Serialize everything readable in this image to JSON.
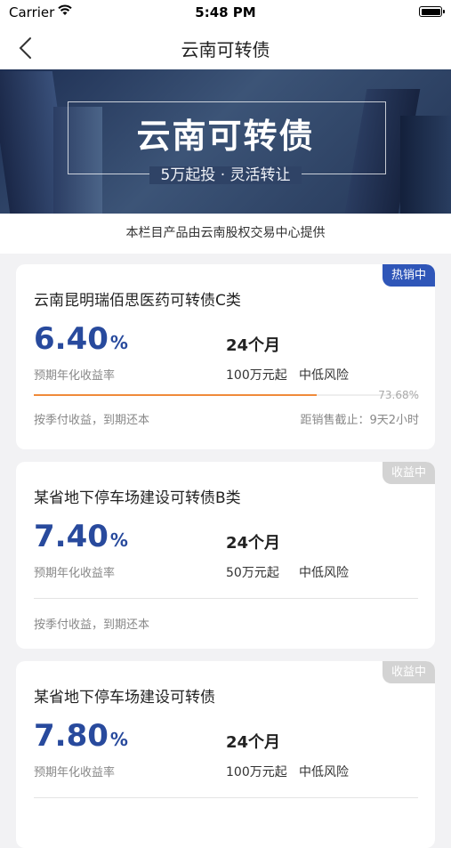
{
  "status": {
    "carrier": "Carrier",
    "time": "5:48 PM"
  },
  "nav": {
    "title": "云南可转债"
  },
  "banner": {
    "title": "云南可转债",
    "subtitle": "5万起投 · 灵活转让"
  },
  "provider_note": "本栏目产品由云南股权交易中心提供",
  "products": [
    {
      "tag": "热销中",
      "tag_color": "#2f56b8",
      "name": "云南昆明瑞佰思医药可转债C类",
      "rate": "6.40",
      "rate_unit": "%",
      "rate_label": "预期年化收益率",
      "term": "24个月",
      "min_invest": "100万元起",
      "risk": "中低风险",
      "progress_percent": 73.68,
      "progress_text": "73.68%",
      "payment": "按季付收益，到期还本",
      "deadline": "距销售截止：9天2小时"
    },
    {
      "tag": "收益中",
      "tag_color": "#d3d3d3",
      "name": "某省地下停车场建设可转债B类",
      "rate": "7.40",
      "rate_unit": "%",
      "rate_label": "预期年化收益率",
      "term": "24个月",
      "min_invest": "50万元起",
      "risk": "中低风险",
      "payment": "按季付收益，到期还本"
    },
    {
      "tag": "收益中",
      "tag_color": "#d3d3d3",
      "name": "某省地下停车场建设可转债",
      "rate": "7.80",
      "rate_unit": "%",
      "rate_label": "预期年化收益率",
      "term": "24个月",
      "min_invest": "100万元起",
      "risk": "中低风险"
    }
  ]
}
